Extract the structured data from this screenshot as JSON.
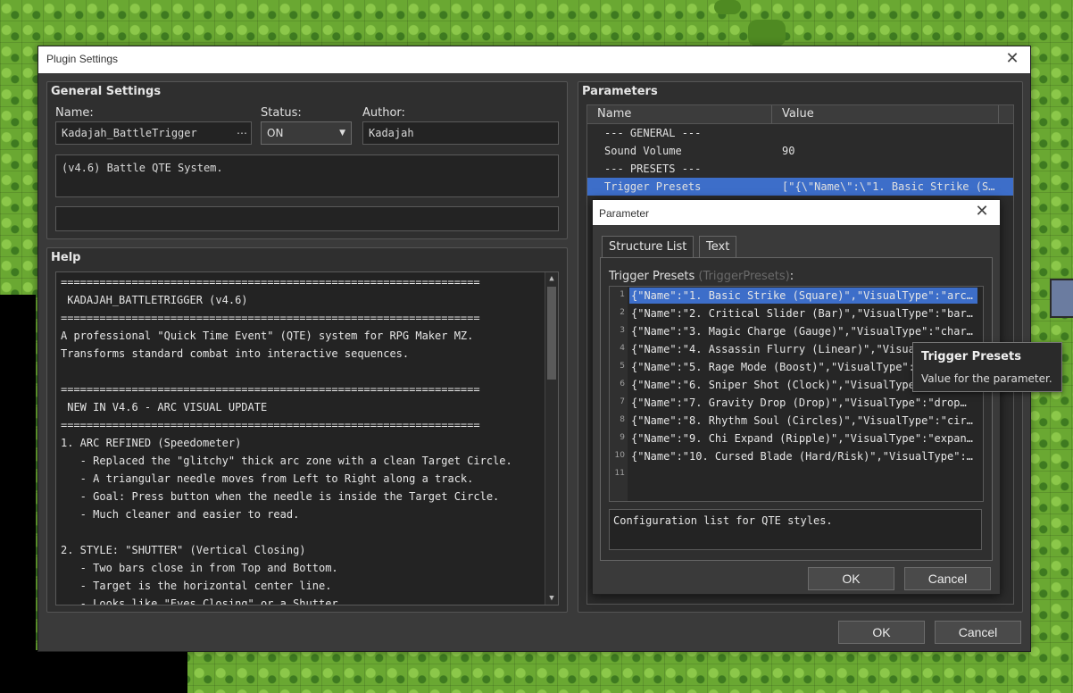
{
  "window": {
    "title": "Plugin Settings",
    "close_glyph": "✕"
  },
  "general": {
    "title": "General Settings",
    "name_label": "Name:",
    "name_value": "Kadajah_BattleTrigger",
    "name_button": "⋯",
    "status_label": "Status:",
    "status_value": "ON",
    "author_label": "Author:",
    "author_value": "Kadajah",
    "description": "(v4.6) Battle QTE System.",
    "extra": ""
  },
  "help": {
    "title": "Help",
    "lines": [
      "=================================================================",
      " KADAJAH_BATTLETRIGGER (v4.6)",
      "=================================================================",
      "A professional \"Quick Time Event\" (QTE) system for RPG Maker MZ.",
      "Transforms standard combat into interactive sequences.",
      "",
      "=================================================================",
      " NEW IN V4.6 - ARC VISUAL UPDATE",
      "=================================================================",
      "1. ARC REFINED (Speedometer)",
      "   - Replaced the \"glitchy\" thick arc zone with a clean Target Circle.",
      "   - A triangular needle moves from Left to Right along a track.",
      "   - Goal: Press button when the needle is inside the Target Circle.",
      "   - Much cleaner and easier to read.",
      "",
      "2. STYLE: \"SHUTTER\" (Vertical Closing)",
      "   - Two bars close in from Top and Bottom.",
      "   - Target is the horizontal center line.",
      "   - Looks like \"Eyes Closing\" or a Shutter."
    ]
  },
  "parameters": {
    "title": "Parameters",
    "col_name": "Name",
    "col_value": "Value",
    "rows": [
      {
        "name": "--- GENERAL ---",
        "value": ""
      },
      {
        "name": "Sound Volume",
        "value": "90"
      },
      {
        "name": "--- PRESETS ---",
        "value": ""
      },
      {
        "name": "Trigger Presets",
        "value": "[\"{\\\"Name\\\":\\\"1. Basic Strike (S…"
      }
    ]
  },
  "param_dialog": {
    "title": "Parameter",
    "tab_structure": "Structure List",
    "tab_text": "Text",
    "list_label": "Trigger Presets",
    "list_key": "(TriggerPresets)",
    "list_colon": ":",
    "items": [
      {
        "num": "1",
        "text": "{\"Name\":\"1. Basic Strike (Square)\",\"VisualType\":\"arc…"
      },
      {
        "num": "2",
        "text": "{\"Name\":\"2. Critical Slider (Bar)\",\"VisualType\":\"bar…"
      },
      {
        "num": "3",
        "text": "{\"Name\":\"3. Magic Charge (Gauge)\",\"VisualType\":\"char…"
      },
      {
        "num": "4",
        "text": "{\"Name\":\"4. Assassin Flurry (Linear)\",\"Visua…"
      },
      {
        "num": "5",
        "text": "{\"Name\":\"5. Rage Mode (Boost)\",\"VisualType\":…"
      },
      {
        "num": "6",
        "text": "{\"Name\":\"6. Sniper Shot (Clock)\",\"VisualType…"
      },
      {
        "num": "7",
        "text": "{\"Name\":\"7. Gravity Drop (Drop)\",\"VisualType\":\"drop…"
      },
      {
        "num": "8",
        "text": "{\"Name\":\"8. Rhythm Soul (Circles)\",\"VisualType\":\"cir…"
      },
      {
        "num": "9",
        "text": "{\"Name\":\"9. Chi Expand (Ripple)\",\"VisualType\":\"expan…"
      },
      {
        "num": "10",
        "text": "{\"Name\":\"10. Cursed Blade (Hard/Risk)\",\"VisualType\":…"
      },
      {
        "num": "11",
        "text": ""
      }
    ],
    "description": "Configuration list for QTE styles.",
    "ok": "OK",
    "cancel": "Cancel"
  },
  "tooltip": {
    "title": "Trigger Presets",
    "text": "Value for the parameter."
  },
  "footer": {
    "ok": "OK",
    "cancel": "Cancel"
  },
  "colors": {
    "selection": "#3d6ec9",
    "panel": "#2f2f2f",
    "field": "#232323"
  }
}
